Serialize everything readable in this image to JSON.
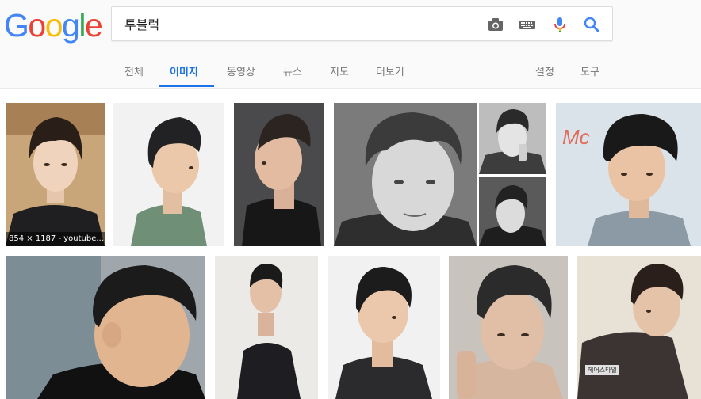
{
  "logo": {
    "letters": [
      "G",
      "o",
      "o",
      "g",
      "l",
      "e"
    ],
    "colors": [
      "#4285f4",
      "#ea4335",
      "#fbbc05",
      "#4285f4",
      "#34a853",
      "#ea4335"
    ]
  },
  "search": {
    "query": "투블럭",
    "icons": [
      "camera-icon",
      "keyboard-icon",
      "microphone-icon",
      "search-icon"
    ]
  },
  "tabs": {
    "items": [
      "전체",
      "이미지",
      "동영상",
      "뉴스",
      "지도",
      "더보기"
    ],
    "active": "이미지",
    "right": [
      "설정",
      "도구"
    ]
  },
  "results": {
    "overlay_text": "854 × 1187 - youtube....",
    "watermark_text": "헤어스타일"
  },
  "colors": {
    "accent": "#1a73e8",
    "tab_text": "#777777",
    "header_bg": "#fafafa"
  }
}
